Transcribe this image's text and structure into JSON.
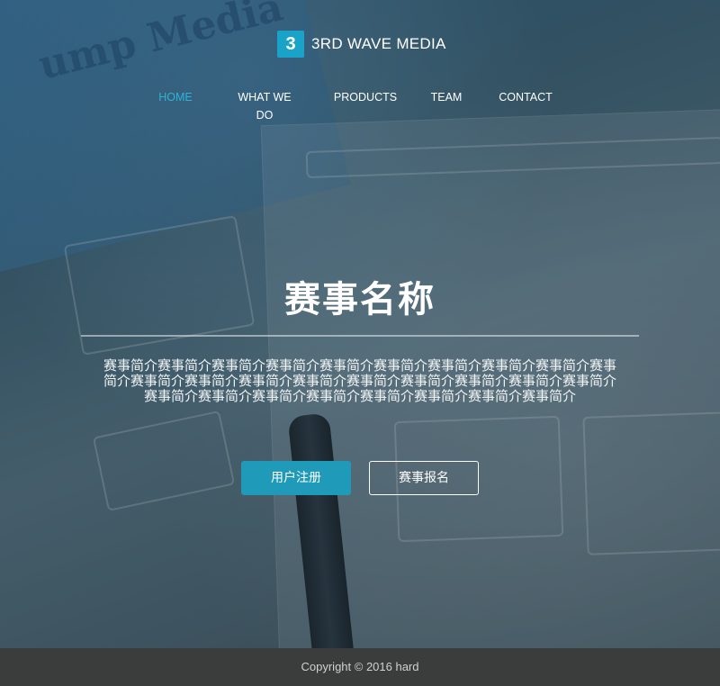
{
  "brand": {
    "logo_glyph": "3",
    "name": "3RD WAVE MEDIA",
    "accent_color": "#1aa3c9"
  },
  "nav": {
    "items": [
      {
        "label": "HOME",
        "active": true
      },
      {
        "label": "WHAT WE DO",
        "active": false
      },
      {
        "label": "PRODUCTS",
        "active": false
      },
      {
        "label": "TEAM",
        "active": false
      },
      {
        "label": "CONTACT",
        "active": false
      }
    ],
    "active_color": "#2eb3d6"
  },
  "hero": {
    "title": "赛事名称",
    "intro": "赛事简介赛事简介赛事简介赛事简介赛事简介赛事简介赛事简介赛事简介赛事简介赛事简介赛事简介赛事简介赛事简介赛事简介赛事简介赛事简介赛事简介赛事简介赛事简介赛事简介赛事简介赛事简介赛事简介赛事简介赛事简介赛事简介赛事简介",
    "register_button": "用户注册",
    "signup_button": "赛事报名",
    "button_color": "#1f9ab8",
    "background_text": "ump Media"
  },
  "footer": {
    "copyright": "Copyright © 2016 hard"
  }
}
